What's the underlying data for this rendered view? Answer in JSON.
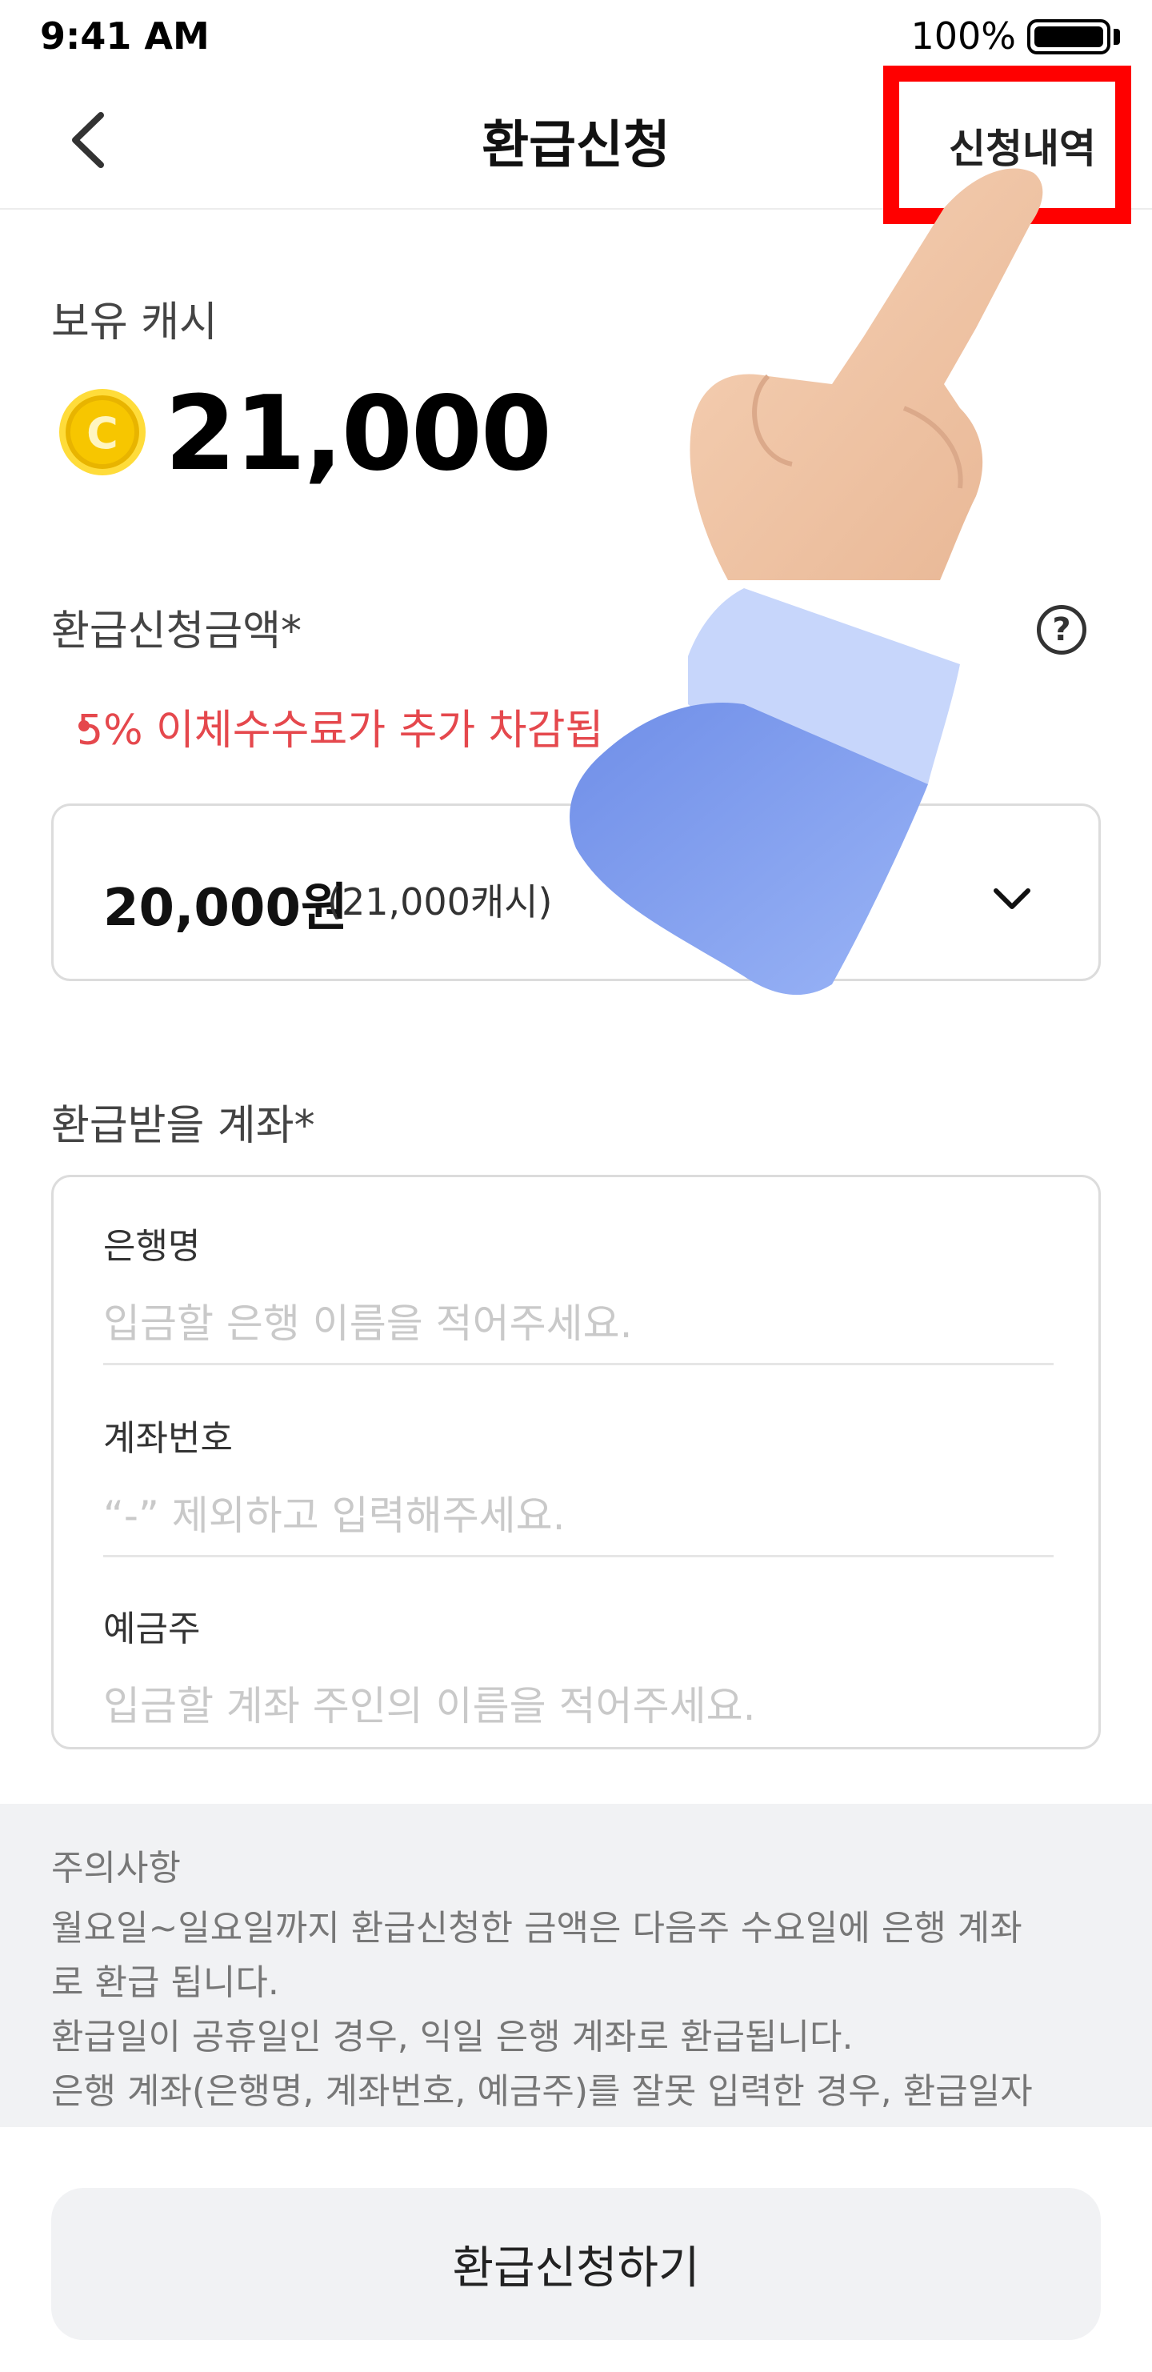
{
  "status_bar": {
    "time": "9:41 AM",
    "battery_percent": "100%",
    "battery_icon": "battery-full-icon"
  },
  "header": {
    "back_icon": "chevron-left-icon",
    "title": "환급신청",
    "history_link": "신청내역",
    "highlight_color": "#ff0000"
  },
  "cash": {
    "label": "보유 캐시",
    "coin_icon": "coin-icon",
    "coin_letter": "C",
    "amount": "21,000"
  },
  "refund_amount": {
    "label": "환급신청금액*",
    "help_icon": "question-circle-icon",
    "help_symbol": "?",
    "fee_notice": "5% 이체수수료가 추가 차감됩",
    "selected_value": "20,000원",
    "selected_sub": "(21,000캐시)",
    "dropdown_icon": "chevron-down-icon"
  },
  "account": {
    "label": "환급받을 계좌*",
    "fields": [
      {
        "label": "은행명",
        "placeholder": "입금할 은행 이름을 적어주세요."
      },
      {
        "label": "계좌번호",
        "placeholder": "“-” 제외하고 입력해주세요."
      },
      {
        "label": "예금주",
        "placeholder": "입금할 계좌 주인의 이름을 적어주세요."
      }
    ]
  },
  "notice": {
    "title": "주의사항",
    "lines": [
      "월요일~일요일까지 환급신청한 금액은 다음주 수요일에 은행 계좌",
      "로 환급 됩니다.",
      "환급일이 공휴일인 경우, 익일 은행 계좌로 환급됩니다.",
      "은행 계좌(은행명, 계좌번호, 예금주)를 잘못 입력한 경우, 환급일자"
    ]
  },
  "submit": {
    "label": "환급신청하기"
  },
  "colors": {
    "accent_red": "#e5484d",
    "coin_yellow": "#f7c600",
    "sleeve_blue": "#7f9ef0",
    "skin": "#f1c7a6"
  }
}
